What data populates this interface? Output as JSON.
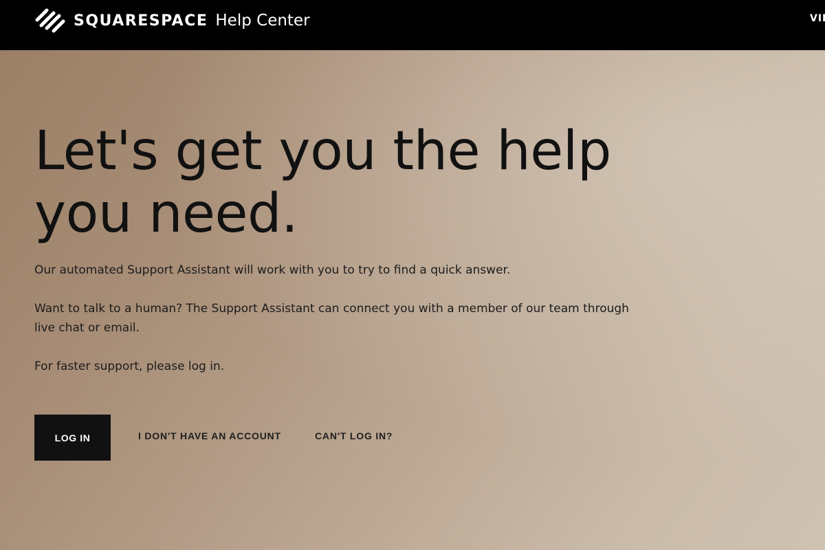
{
  "header": {
    "brand_name": "SQUARESPACE",
    "section_title": "Help Center",
    "nav_partial": "VIDEOS",
    "logo_icon": "squarespace-logo-icon"
  },
  "hero": {
    "headline": "Let's get you the help you need.",
    "paragraphs": [
      "Our automated Support Assistant will work with you to try to find a quick answer.",
      "Want to talk to a human? The Support Assistant can connect you with a member of our team through live chat or email.",
      "For faster support, please log in."
    ],
    "actions": {
      "login_label": "LOG IN",
      "no_account_label": "I DON'T HAVE AN ACCOUNT",
      "cant_login_label": "CAN'T LOG IN?"
    }
  },
  "colors": {
    "header_bg": "#000000",
    "header_text": "#ffffff",
    "hero_bg_start": "#9b7f66",
    "hero_bg_end": "#cfc2b3",
    "primary_button_bg": "#111111",
    "text_dark": "#111111"
  }
}
